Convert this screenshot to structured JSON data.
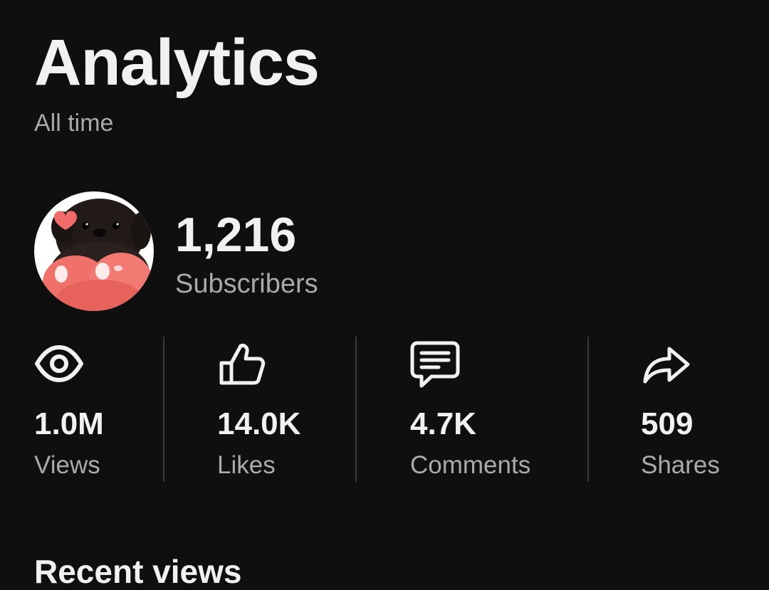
{
  "header": {
    "title": "Analytics",
    "subtitle": "All time"
  },
  "channel": {
    "avatar_icon": "pug-with-heart-avatar",
    "subscriber_count": "1,216",
    "subscriber_label": "Subscribers"
  },
  "stats": [
    {
      "icon": "eye-icon",
      "value": "1.0M",
      "label": "Views"
    },
    {
      "icon": "thumbs-up-icon",
      "value": "14.0K",
      "label": "Likes"
    },
    {
      "icon": "comment-icon",
      "value": "4.7K",
      "label": "Comments"
    },
    {
      "icon": "share-icon",
      "value": "509",
      "label": "Shares"
    }
  ],
  "sections": {
    "recent_views_heading": "Recent views"
  },
  "colors": {
    "background": "#0f0f0f",
    "primary_text": "#f1f1f1",
    "secondary_text": "#aaaaaa",
    "divider": "#3a3a3a"
  }
}
